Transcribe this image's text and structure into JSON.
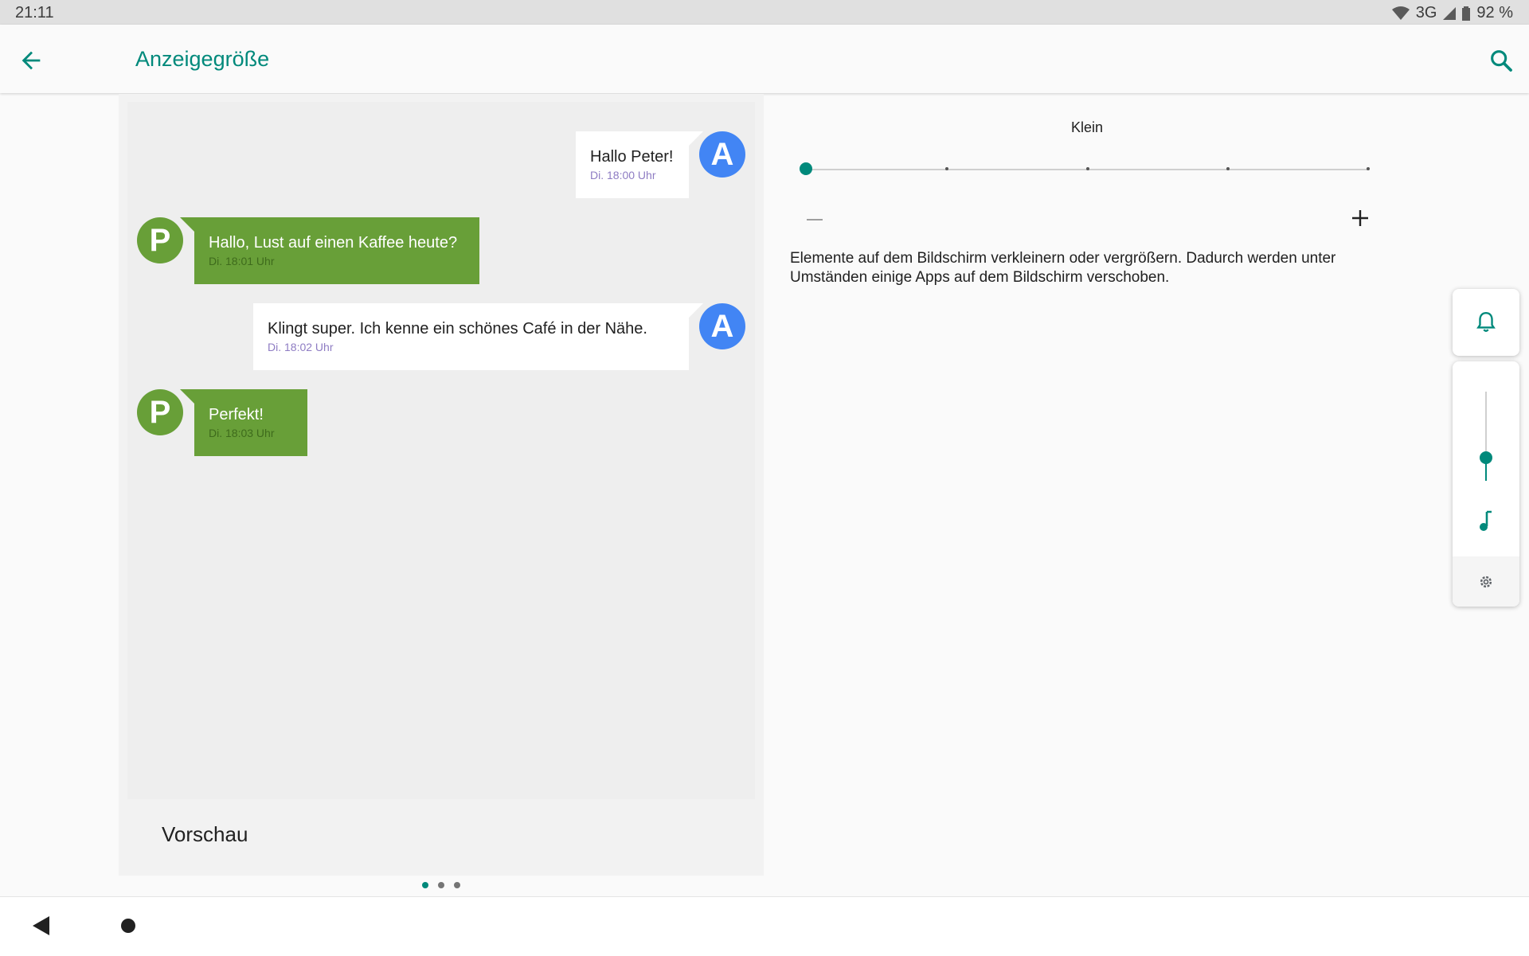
{
  "status_bar": {
    "time": "21:11",
    "network": "3G",
    "battery": "92 %"
  },
  "app_bar": {
    "title": "Anzeigegröße"
  },
  "preview": {
    "label": "Vorschau",
    "messages": [
      {
        "author_initial": "A",
        "text": "Hallo Peter!",
        "time": "Di. 18:00 Uhr"
      },
      {
        "author_initial": "P",
        "text": "Hallo, Lust auf einen Kaffee heute?",
        "time": "Di. 18:01 Uhr"
      },
      {
        "author_initial": "A",
        "text": "Klingt super. Ich kenne ein schönes Café in der Nähe.",
        "time": "Di. 18:02 Uhr"
      },
      {
        "author_initial": "P",
        "text": "Perfekt!",
        "time": "Di. 18:03 Uhr"
      }
    ],
    "pages": 3,
    "current_page": 1
  },
  "size_slider": {
    "current_label": "Klein",
    "steps": 5,
    "current_step": 1,
    "description": "Elemente auf dem Bildschirm verkleinern oder vergrößern. Dadurch werden unter Umständen einige Apps auf dem Bildschirm verschoben."
  },
  "volume_panel": {
    "level_fraction": 0.74
  },
  "colors": {
    "accent": "#00897b",
    "incoming_bubble": "#689f38",
    "avatar_a": "#4285f4"
  },
  "icons": [
    "back-arrow-icon",
    "search-icon",
    "wifi-icon",
    "cell-signal-icon",
    "battery-icon",
    "bell-icon",
    "music-note-icon",
    "gear-icon",
    "nav-back-icon",
    "nav-home-icon"
  ]
}
